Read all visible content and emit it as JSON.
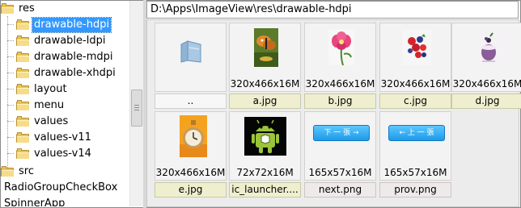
{
  "tree": {
    "items": [
      {
        "label": "res",
        "level": 0,
        "selected": false
      },
      {
        "label": "drawable-hdpi",
        "level": 1,
        "selected": true
      },
      {
        "label": "drawable-ldpi",
        "level": 1,
        "selected": false
      },
      {
        "label": "drawable-mdpi",
        "level": 1,
        "selected": false
      },
      {
        "label": "drawable-xhdpi",
        "level": 1,
        "selected": false
      },
      {
        "label": "layout",
        "level": 1,
        "selected": false
      },
      {
        "label": "menu",
        "level": 1,
        "selected": false
      },
      {
        "label": "values",
        "level": 1,
        "selected": false
      },
      {
        "label": "values-v11",
        "level": 1,
        "selected": false
      },
      {
        "label": "values-v14",
        "level": 1,
        "selected": false
      },
      {
        "label": "src",
        "level": 0,
        "selected": false
      },
      {
        "label": "RadioGroupCheckBox",
        "level": -1,
        "selected": false
      },
      {
        "label": "SpinnerApp",
        "level": -1,
        "selected": false
      }
    ]
  },
  "path": "D:\\Apps\\ImageView\\res\\drawable-hdpi",
  "files": [
    {
      "name": "..",
      "dims": "",
      "thumb": "folder-up-icon",
      "kind": "plain"
    },
    {
      "name": "a.jpg",
      "dims": "320x466x16M",
      "thumb": "butterfly-photo",
      "kind": "jpg"
    },
    {
      "name": "b.jpg",
      "dims": "320x466x16M",
      "thumb": "flower-photo",
      "kind": "jpg"
    },
    {
      "name": "c.jpg",
      "dims": "320x466x16M",
      "thumb": "berries-photo",
      "kind": "jpg"
    },
    {
      "name": "d.jpg",
      "dims": "320x466x16M",
      "thumb": "dessert-photo",
      "kind": "jpg"
    },
    {
      "name": "e.jpg",
      "dims": "320x466x16M",
      "thumb": "clock-photo",
      "kind": "jpg"
    },
    {
      "name": "ic_launcher....",
      "dims": "72x72x16M",
      "thumb": "android-icon",
      "kind": "jpg"
    },
    {
      "name": "next.png",
      "dims": "165x57x16M",
      "thumb": "next-button-image",
      "kind": "png",
      "button_text": "下 一 張 →"
    },
    {
      "name": "prov.png",
      "dims": "165x57x16M",
      "thumb": "prev-button-image",
      "kind": "png",
      "button_text": "← 上 一 張"
    }
  ],
  "colors": {
    "selection": "#3399ff",
    "jpg_label": "#efefd0",
    "png_label": "#eeeaea",
    "button": "#1c9be8"
  }
}
